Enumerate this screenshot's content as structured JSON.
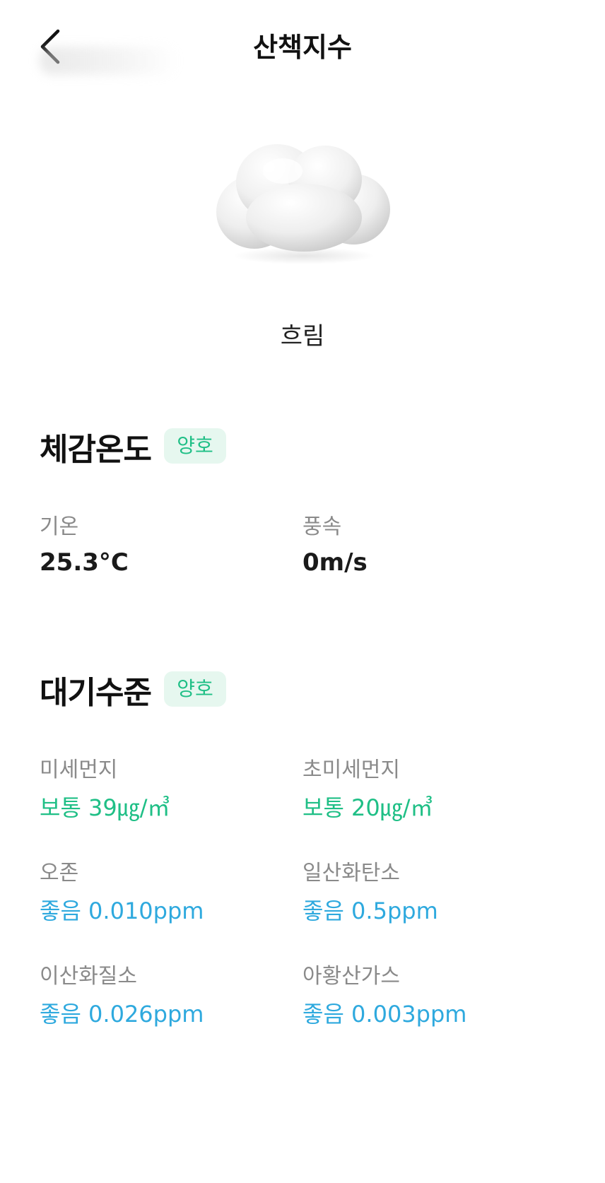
{
  "header": {
    "title": "산책지수"
  },
  "weather": {
    "icon": "cloud-icon",
    "condition": "흐림"
  },
  "feels_like": {
    "title": "체감온도",
    "badge": "양호",
    "fields": [
      {
        "label": "기온",
        "value": "25.3°C"
      },
      {
        "label": "풍속",
        "value": "0m/s"
      }
    ]
  },
  "air_quality": {
    "title": "대기수준",
    "badge": "양호",
    "items": [
      {
        "label": "미세먼지",
        "value": "보통 39㎍/㎥",
        "status": "normal"
      },
      {
        "label": "초미세먼지",
        "value": "보통 20㎍/㎥",
        "status": "normal"
      },
      {
        "label": "오존",
        "value": "좋음 0.010ppm",
        "status": "good"
      },
      {
        "label": "일산화탄소",
        "value": "좋음 0.5ppm",
        "status": "good"
      },
      {
        "label": "이산화질소",
        "value": "좋음 0.026ppm",
        "status": "good"
      },
      {
        "label": "아황산가스",
        "value": "좋음 0.003ppm",
        "status": "good"
      }
    ]
  },
  "colors": {
    "status_normal": "#1fbf86",
    "status_good": "#2ea9de",
    "badge_background": "#e6f7ef"
  }
}
